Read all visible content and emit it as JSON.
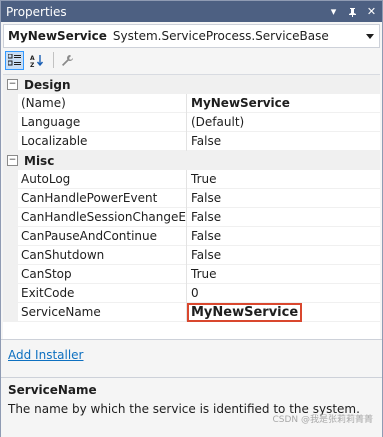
{
  "window": {
    "title": "Properties",
    "controls": [
      "chevron-down-icon",
      "pin-icon",
      "close-icon"
    ]
  },
  "object_selector": {
    "name": "MyNewService",
    "type": "System.ServiceProcess.ServiceBase"
  },
  "toolbar": {
    "buttons": [
      "categorized-icon",
      "alphabetical-icon",
      "property-pages-icon"
    ]
  },
  "grid": {
    "categories": [
      {
        "name": "Design",
        "properties": [
          {
            "name": "(Name)",
            "value": "MyNewService",
            "bold": true
          },
          {
            "name": "Language",
            "value": "(Default)"
          },
          {
            "name": "Localizable",
            "value": "False"
          }
        ]
      },
      {
        "name": "Misc",
        "properties": [
          {
            "name": "AutoLog",
            "value": "True"
          },
          {
            "name": "CanHandlePowerEvent",
            "value": "False"
          },
          {
            "name": "CanHandleSessionChangeEven",
            "value": "False"
          },
          {
            "name": "CanPauseAndContinue",
            "value": "False"
          },
          {
            "name": "CanShutdown",
            "value": "False"
          },
          {
            "name": "CanStop",
            "value": "True"
          },
          {
            "name": "ExitCode",
            "value": "0"
          },
          {
            "name": "ServiceName",
            "value": "MyNewService",
            "editing": true
          }
        ]
      }
    ]
  },
  "commands": {
    "add_installer": "Add Installer"
  },
  "description": {
    "name": "ServiceName",
    "text": "The name by which the service is identified to the system."
  },
  "watermark": "CSDN @我是张莉莉菁菁",
  "colors": {
    "titlebar": "#4d6082",
    "link": "#0e70c0",
    "edit_highlight": "#d9472e"
  }
}
